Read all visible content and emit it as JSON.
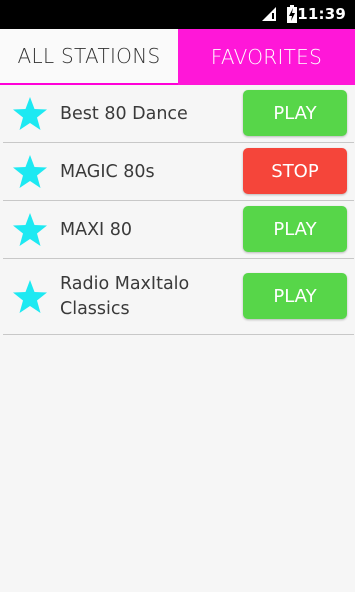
{
  "status_bar": {
    "time": "11:39"
  },
  "tabs": [
    {
      "label": "ALL STATIONS",
      "selected": false
    },
    {
      "label": "FAVORITES",
      "selected": true
    }
  ],
  "stations": [
    {
      "name": "Best 80 Dance",
      "action": "PLAY",
      "favorite": true
    },
    {
      "name": "MAGIC 80s",
      "action": "STOP",
      "favorite": true
    },
    {
      "name": "MAXI 80",
      "action": "PLAY",
      "favorite": true
    },
    {
      "name_line1": "Radio MaxItalo",
      "name_line2": "Classics",
      "action": "PLAY",
      "favorite": true
    }
  ],
  "colors": {
    "accent": "#ff17d8",
    "star": "#1de9f2",
    "play": "#57d649",
    "stop": "#f5453a"
  }
}
